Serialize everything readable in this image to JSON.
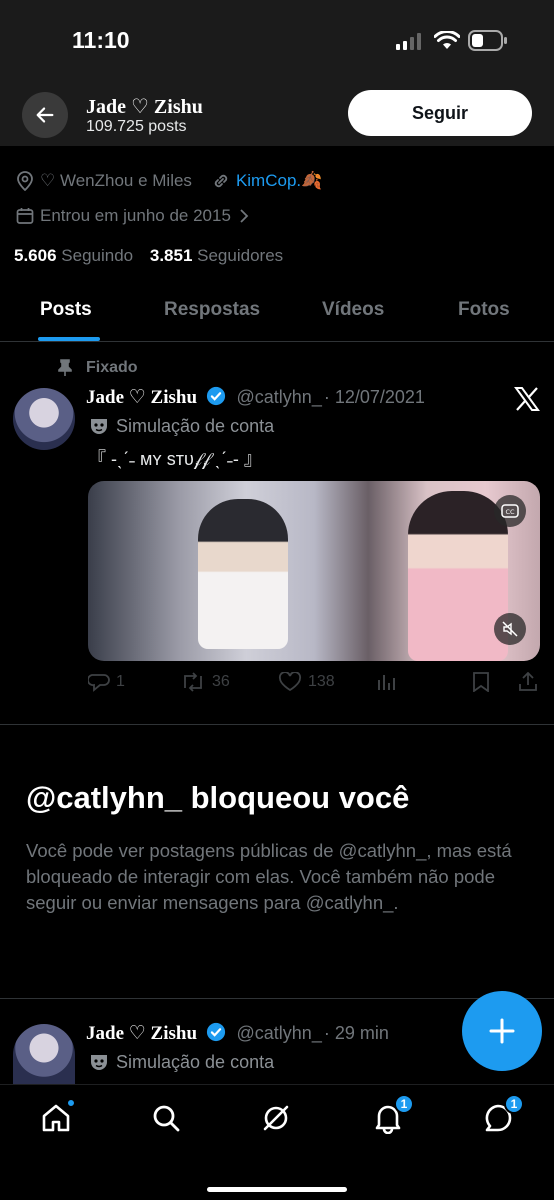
{
  "status": {
    "time": "11:10"
  },
  "header": {
    "name": "Jade ♡ Zishu",
    "posts_count": "109.725 posts",
    "follow_label": "Seguir"
  },
  "profile": {
    "location": "♡ WenZhou e Miles",
    "link": "KimCop.🍂",
    "joined": "Entrou em junho de 2015",
    "following_count": "5.606",
    "following_label": "Seguindo",
    "followers_count": "3.851",
    "followers_label": "Seguidores"
  },
  "tabs": [
    {
      "label": "Posts"
    },
    {
      "label": "Respostas"
    },
    {
      "label": "Vídeos"
    },
    {
      "label": "Fotos"
    }
  ],
  "pinned_tweet": {
    "pinned_label": "Fixado",
    "name": "Jade ♡ Zishu",
    "handle": "@catlyhn_",
    "date": "· 12/07/2021",
    "sim_label": "Simulação de conta",
    "text": "『 -ˎˊ˗ ᴍʏ sᴛᴜ𝒻𝒻 ˎˊ˗- 』",
    "replies": "1",
    "retweets": "36",
    "likes": "138"
  },
  "blocked": {
    "title": "@catlyhn_ bloqueou você",
    "body": "Você pode ver postagens públicas de @catlyhn_, mas está bloqueado de interagir com elas. Você também não pode seguir ou enviar mensagens para @catlyhn_."
  },
  "second_tweet": {
    "name": "Jade ♡ Zishu",
    "handle": "@catlyhn_",
    "date": "· 29 min",
    "sim_label": "Simulação de conta"
  },
  "nav": {
    "notifications_badge": "1",
    "messages_badge": "1"
  },
  "colors": {
    "accent": "#1d9bf0",
    "background": "#000000",
    "muted": "#71767b"
  }
}
